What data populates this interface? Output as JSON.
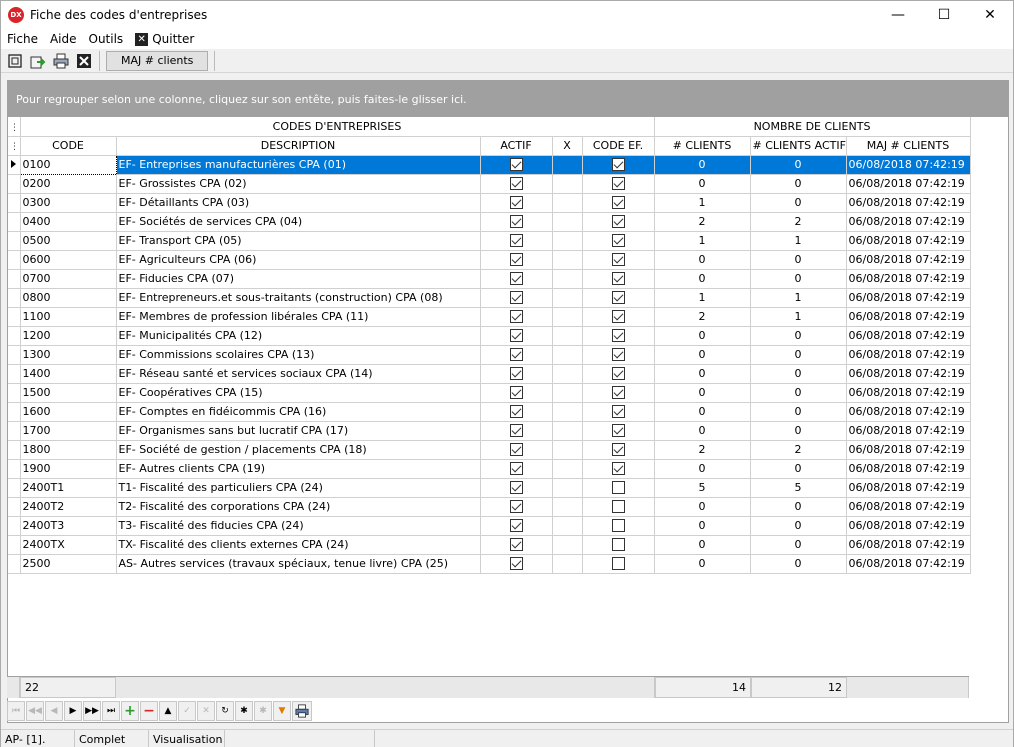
{
  "window": {
    "title": "Fiche des codes d'entreprises",
    "app_icon_text": "DX",
    "minimize": "—",
    "maximize": "☐",
    "close": "✕"
  },
  "menu": {
    "fiche": "Fiche",
    "aide": "Aide",
    "outils": "Outils",
    "quitter": "Quitter"
  },
  "toolbar": {
    "maj_label": "MAJ # clients"
  },
  "group_panel": "Pour regrouper selon une colonne, cliquez sur son entête, puis faites-le glisser ici.",
  "bands": {
    "codes": "CODES D'ENTREPRISES",
    "nombre": "NOMBRE DE CLIENTS"
  },
  "columns": {
    "code": "CODE",
    "description": "DESCRIPTION",
    "actif": "ACTIF",
    "x": "X",
    "code_ef": "CODE EF.",
    "clients": "# CLIENTS",
    "clients_actifs": "# CLIENTS ACTIFS",
    "maj": "MAJ # CLIENTS"
  },
  "rows": [
    {
      "code": "0100",
      "description": "EF- Entreprises manufacturières CPA (01)",
      "actif": true,
      "code_ef": true,
      "clients": "0",
      "actifs": "0",
      "maj": "06/08/2018 07:42:19",
      "selected": true
    },
    {
      "code": "0200",
      "description": "EF- Grossistes CPA (02)",
      "actif": true,
      "code_ef": true,
      "clients": "0",
      "actifs": "0",
      "maj": "06/08/2018 07:42:19"
    },
    {
      "code": "0300",
      "description": "EF- Détaillants CPA (03)",
      "actif": true,
      "code_ef": true,
      "clients": "1",
      "actifs": "0",
      "maj": "06/08/2018 07:42:19"
    },
    {
      "code": "0400",
      "description": "EF- Sociétés de services CPA (04)",
      "actif": true,
      "code_ef": true,
      "clients": "2",
      "actifs": "2",
      "maj": "06/08/2018 07:42:19"
    },
    {
      "code": "0500",
      "description": "EF- Transport CPA  (05)",
      "actif": true,
      "code_ef": true,
      "clients": "1",
      "actifs": "1",
      "maj": "06/08/2018 07:42:19"
    },
    {
      "code": "0600",
      "description": "EF- Agriculteurs CPA (06)",
      "actif": true,
      "code_ef": true,
      "clients": "0",
      "actifs": "0",
      "maj": "06/08/2018 07:42:19"
    },
    {
      "code": "0700",
      "description": "EF- Fiducies CPA (07)",
      "actif": true,
      "code_ef": true,
      "clients": "0",
      "actifs": "0",
      "maj": "06/08/2018 07:42:19"
    },
    {
      "code": "0800",
      "description": "EF- Entrepreneurs.et sous-traitants (construction) CPA (08)",
      "actif": true,
      "code_ef": true,
      "clients": "1",
      "actifs": "1",
      "maj": "06/08/2018 07:42:19"
    },
    {
      "code": "1100",
      "description": "EF- Membres de profession libérales CPA (11)",
      "actif": true,
      "code_ef": true,
      "clients": "2",
      "actifs": "1",
      "maj": "06/08/2018 07:42:19"
    },
    {
      "code": "1200",
      "description": "EF- Municipalités CPA (12)",
      "actif": true,
      "code_ef": true,
      "clients": "0",
      "actifs": "0",
      "maj": "06/08/2018 07:42:19"
    },
    {
      "code": "1300",
      "description": "EF- Commissions scolaires CPA (13)",
      "actif": true,
      "code_ef": true,
      "clients": "0",
      "actifs": "0",
      "maj": "06/08/2018 07:42:19"
    },
    {
      "code": "1400",
      "description": "EF- Réseau santé et services sociaux CPA (14)",
      "actif": true,
      "code_ef": true,
      "clients": "0",
      "actifs": "0",
      "maj": "06/08/2018 07:42:19"
    },
    {
      "code": "1500",
      "description": "EF- Coopératives CPA (15)",
      "actif": true,
      "code_ef": true,
      "clients": "0",
      "actifs": "0",
      "maj": "06/08/2018 07:42:19"
    },
    {
      "code": "1600",
      "description": "EF- Comptes en fidéicommis CPA (16)",
      "actif": true,
      "code_ef": true,
      "clients": "0",
      "actifs": "0",
      "maj": "06/08/2018 07:42:19"
    },
    {
      "code": "1700",
      "description": "EF- Organismes sans but lucratif CPA (17)",
      "actif": true,
      "code_ef": true,
      "clients": "0",
      "actifs": "0",
      "maj": "06/08/2018 07:42:19"
    },
    {
      "code": "1800",
      "description": "EF- Société de gestion / placements CPA (18)",
      "actif": true,
      "code_ef": true,
      "clients": "2",
      "actifs": "2",
      "maj": "06/08/2018 07:42:19"
    },
    {
      "code": "1900",
      "description": "EF- Autres clients CPA (19)",
      "actif": true,
      "code_ef": true,
      "clients": "0",
      "actifs": "0",
      "maj": "06/08/2018 07:42:19"
    },
    {
      "code": "2400T1",
      "description": "T1- Fiscalité des particuliers CPA (24)",
      "actif": true,
      "code_ef": false,
      "clients": "5",
      "actifs": "5",
      "maj": "06/08/2018 07:42:19"
    },
    {
      "code": "2400T2",
      "description": "T2- Fiscalité des corporations CPA (24)",
      "actif": true,
      "code_ef": false,
      "clients": "0",
      "actifs": "0",
      "maj": "06/08/2018 07:42:19"
    },
    {
      "code": "2400T3",
      "description": "T3- Fiscalité des fiducies  CPA (24)",
      "actif": true,
      "code_ef": false,
      "clients": "0",
      "actifs": "0",
      "maj": "06/08/2018 07:42:19"
    },
    {
      "code": "2400TX",
      "description": "TX- Fiscalité des clients externes CPA (24)",
      "actif": true,
      "code_ef": false,
      "clients": "0",
      "actifs": "0",
      "maj": "06/08/2018 07:42:19"
    },
    {
      "code": "2500",
      "description": "AS- Autres services (travaux spéciaux, tenue livre) CPA (25)",
      "actif": true,
      "code_ef": false,
      "clients": "0",
      "actifs": "0",
      "maj": "06/08/2018 07:42:19"
    }
  ],
  "summary": {
    "count": "22",
    "total_clients": "14",
    "total_actifs": "12"
  },
  "status": {
    "ap": "AP- [1].",
    "complet": "Complet",
    "visualisation": "Visualisation"
  }
}
